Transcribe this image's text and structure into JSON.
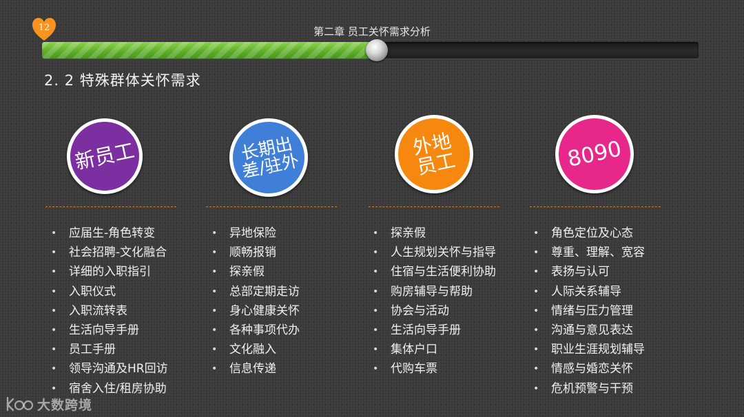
{
  "page": {
    "number": "12",
    "chapter_title": "第二章  员工关怀需求分析",
    "section_title": "2. 2  特殊群体关怀需求",
    "progress": 0.51
  },
  "colors": {
    "badge": "#f7931e",
    "progress_fill": "#6ab534",
    "divider": "#c9833d"
  },
  "columns": [
    {
      "circle_label": "新员工",
      "circle_color": "#7b2fa0",
      "items": [
        "应届生-角色转变",
        "社会招聘-文化融合",
        "详细的入职指引",
        "入职仪式",
        "入职流转表",
        "生活向导手册",
        "员工手册",
        "领导沟通及HR回访",
        "宿舍入住/租房协助"
      ]
    },
    {
      "circle_label": "长期出\n差/驻外",
      "circle_color": "#3f7fd8",
      "items": [
        "异地保险",
        "顺畅报销",
        "探亲假",
        "总部定期走访",
        "身心健康关怀",
        "各种事项代办",
        "文化融入",
        "信息传递"
      ]
    },
    {
      "circle_label": "外地\n员工",
      "circle_color": "#f7880f",
      "items": [
        "探亲假",
        "人生规划关怀与指导",
        "住宿与生活便利协助",
        "购房辅导与帮助",
        "协会与活动",
        "生活向导手册",
        "集体户口",
        "代购车票"
      ]
    },
    {
      "circle_label": "8090",
      "circle_color": "#e8278a",
      "items": [
        "角色定位及心态",
        "尊重、理解、宽容",
        "表扬与认可",
        "人际关系辅导",
        "情绪与压力管理",
        "沟通与意见表达",
        "职业生涯规划辅导",
        "情感与婚恋关怀",
        "危机预警与干预"
      ]
    }
  ],
  "watermark": {
    "brand": "大数跨境",
    "logo_icon": "kbo-logo-icon"
  }
}
